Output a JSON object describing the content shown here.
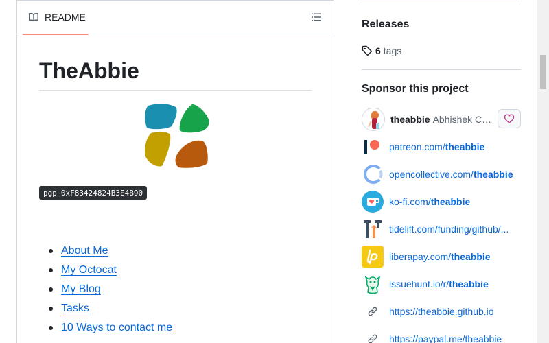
{
  "readme": {
    "tab_label": "README",
    "title": "TheAbbie",
    "pgp_label": "pgp",
    "pgp_value": "0xF83424824B3E4B90",
    "links": [
      {
        "label": "About Me"
      },
      {
        "label": "My Octocat"
      },
      {
        "label": "My Blog"
      },
      {
        "label": "Tasks"
      },
      {
        "label": "10 Ways to contact me"
      }
    ]
  },
  "sidebar": {
    "releases_title": "Releases",
    "tags_count": "6",
    "tags_label": "tags",
    "sponsor_title": "Sponsor this project",
    "sponsor_user": {
      "username": "theabbie",
      "full_name": "Abhishek Ch..."
    },
    "sponsor_links": [
      {
        "icon": "patreon-icon",
        "prefix": "patreon.com/",
        "handle": "theabbie"
      },
      {
        "icon": "opencollective-icon",
        "prefix": "opencollective.com/",
        "handle": "theabbie"
      },
      {
        "icon": "kofi-icon",
        "prefix": "ko-fi.com/",
        "handle": "theabbie"
      },
      {
        "icon": "tidelift-icon",
        "prefix": "tidelift.com/funding/github/...",
        "handle": ""
      },
      {
        "icon": "liberapay-icon",
        "prefix": "liberapay.com/",
        "handle": "theabbie"
      },
      {
        "icon": "issuehunt-icon",
        "prefix": "issuehunt.io/r/",
        "handle": "theabbie"
      },
      {
        "icon": "link-icon",
        "prefix": "https://theabbie.github.io",
        "handle": ""
      },
      {
        "icon": "link-icon",
        "prefix": "https://paypal.me/theabbie",
        "handle": ""
      }
    ]
  },
  "colors": {
    "link": "#0969da",
    "tab_underline": "#fd8c73",
    "border": "#d0d7de"
  }
}
